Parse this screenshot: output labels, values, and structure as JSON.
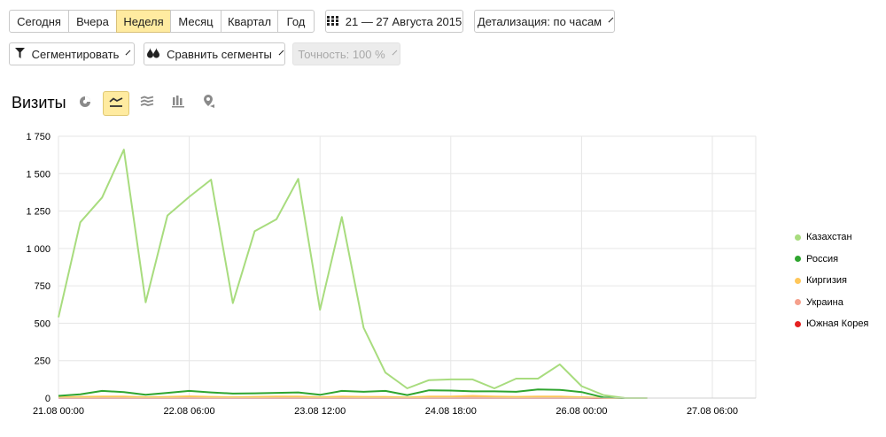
{
  "toolbar": {
    "periods": [
      "Сегодня",
      "Вчера",
      "Неделя",
      "Месяц",
      "Квартал",
      "Год"
    ],
    "active_period": "Неделя",
    "date_range": "21 — 27 Августа 2015",
    "detail": "Детализация: по часам",
    "segment": "Сегментировать",
    "compare": "Сравнить сегменты",
    "accuracy": "Точность: 100 %"
  },
  "chart_title": "Визиты",
  "view_icons": [
    "pie-chart-icon",
    "line-chart-icon",
    "stacked-area-icon",
    "bar-chart-icon",
    "map-icon"
  ],
  "active_view": "line-chart-icon",
  "colors": {
    "Казахстан": "#a8dc7e",
    "Россия": "#2fa52f",
    "Киргизия": "#ffc75a",
    "Украина": "#f5a08c",
    "Южная Корея": "#e52020"
  },
  "chart_data": {
    "type": "line",
    "x_labels": [
      "21.08 00:00",
      "22.08 06:00",
      "23.08 12:00",
      "24.08 18:00",
      "26.08 00:00",
      "27.08 06:00"
    ],
    "x_label_indices": [
      0,
      6,
      12,
      18,
      24,
      30
    ],
    "y_ticks": [
      "0",
      "250",
      "500",
      "750",
      "1 000",
      "1 250",
      "1 500",
      "1 750"
    ],
    "ylim": [
      0,
      1750
    ],
    "grid": true,
    "legend_position": "right",
    "series": [
      {
        "name": "Казахстан",
        "values": [
          540,
          1175,
          1340,
          1660,
          640,
          1220,
          1345,
          1460,
          635,
          1115,
          1195,
          1465,
          590,
          1210,
          470,
          170,
          65,
          120,
          125,
          125,
          65,
          130,
          130,
          225,
          80,
          20,
          0,
          0
        ]
      },
      {
        "name": "Россия",
        "values": [
          15,
          25,
          48,
          40,
          22,
          35,
          48,
          38,
          30,
          32,
          35,
          38,
          22,
          48,
          42,
          48,
          20,
          52,
          50,
          45,
          45,
          42,
          58,
          55,
          40,
          5,
          0,
          0
        ]
      },
      {
        "name": "Киргизия",
        "values": [
          5,
          8,
          10,
          10,
          6,
          8,
          12,
          8,
          6,
          8,
          10,
          10,
          6,
          10,
          8,
          8,
          5,
          10,
          10,
          15,
          10,
          8,
          10,
          10,
          6,
          2,
          0,
          0
        ]
      },
      {
        "name": "Украина",
        "values": [
          3,
          5,
          6,
          6,
          3,
          5,
          6,
          6,
          3,
          5,
          6,
          6,
          3,
          5,
          5,
          5,
          3,
          6,
          6,
          8,
          6,
          5,
          6,
          6,
          4,
          1,
          0,
          0
        ]
      },
      {
        "name": "Южная Корея",
        "values": [
          1,
          1,
          2,
          1,
          1,
          1,
          2,
          1,
          1,
          1,
          2,
          1,
          1,
          1,
          1,
          2,
          1,
          2,
          2,
          2,
          1,
          1,
          2,
          1,
          1,
          0,
          0,
          0
        ]
      }
    ]
  }
}
